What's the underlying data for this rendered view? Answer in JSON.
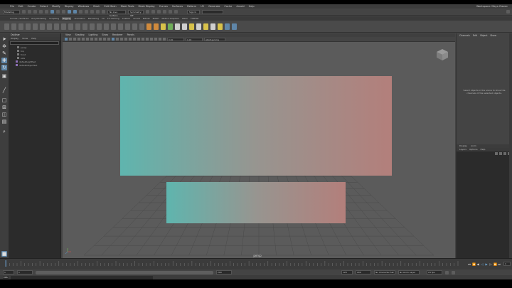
{
  "app": {
    "menu_items": [
      "File",
      "Edit",
      "Create",
      "Select",
      "Modify",
      "Display",
      "Windows",
      "Mesh",
      "Edit Mesh",
      "Mesh Tools",
      "Mesh Display",
      "Curves",
      "Surfaces",
      "Deform",
      "UV",
      "Generate",
      "Cache",
      "Arnold",
      "Help"
    ],
    "workspace_label": "Workspace: Maya Classic",
    "status": {
      "mode": "Modeling",
      "symmetry": "No Live Surface",
      "symmetry_off": "Symmetry: Off",
      "sign_in": "Sign In"
    },
    "shelf_tabs": [
      "Curves / Surfaces",
      "Poly Modeling",
      "Sculpting",
      "Rigging",
      "Animation",
      "Rendering",
      "FX",
      "FX Caching",
      "Custom",
      "Arnold",
      "Bifrost",
      "MASH",
      "Motion Graphics",
      "XGen",
      "TURTLE"
    ],
    "active_shelf_tab": "Rigging"
  },
  "outliner": {
    "title": "Outliner",
    "menu": [
      "Display",
      "Show",
      "Help"
    ],
    "items": [
      "persp",
      "top",
      "front",
      "side",
      "defaultLightSet",
      "defaultObjectSet"
    ]
  },
  "panel": {
    "menu": [
      "View",
      "Shading",
      "Lighting",
      "Show",
      "Renderer",
      "Panels"
    ],
    "colorspace": "sRGB gamma",
    "exposure": "0.00",
    "gamma": "1.00",
    "camera_label": "persp"
  },
  "channel_box": {
    "tabs": [
      "Channels",
      "Edit",
      "Object",
      "Show"
    ],
    "empty_message": "Select objects in the scene to show the channels of the selected objects."
  },
  "layers": {
    "tabs": [
      "Display",
      "Anim"
    ],
    "menu": [
      "Layers",
      "Options",
      "Help"
    ]
  },
  "timeline": {
    "start": 1,
    "end": 120,
    "current_frame": "1",
    "range_start": "1",
    "range_end": "120",
    "playback_start": "1",
    "playback_end": "200",
    "fps": "24 fps",
    "character_set": "No Character Set",
    "anim_layer": "No Anim Layer"
  },
  "command_line": {
    "language": "MEL"
  },
  "viewport": {
    "gradient_left": "#5fb5ae",
    "gradient_right": "#b37f7b",
    "background": "#5b5b5b"
  }
}
